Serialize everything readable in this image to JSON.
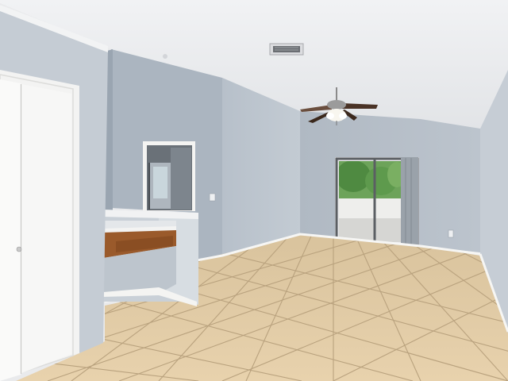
{
  "scene": {
    "kind": "photo",
    "subject": "empty-room-interior",
    "objects": [
      "vaulted-ceiling",
      "hvac-vent",
      "ceiling-fan",
      "sliding-glass-door",
      "closet-double-door",
      "interior-doorway",
      "kitchenette-counter",
      "tile-floor",
      "electrical-outlet",
      "light-switch"
    ]
  },
  "colors": {
    "ceiling": "#eeeff1",
    "wall_back": "#b3bcc6",
    "wall_left_recess": "#a9b3be",
    "wall_middle": "#bcc5ce",
    "wall_right": "#c3cad2",
    "wall_front_left": "#c5ccd4",
    "floor": "#e3cca6",
    "floor_far": "#d6c09a",
    "grout": "#b9a27e",
    "baseboard": "#f5f5f3",
    "door_white": "#f7f7f6",
    "counter_wood": "#9a5a2b",
    "greenery": "#5f9a4f",
    "patio": "#d9d9d6",
    "fan_blade": "#4a3326",
    "fan_metal": "#8a8a8a"
  }
}
